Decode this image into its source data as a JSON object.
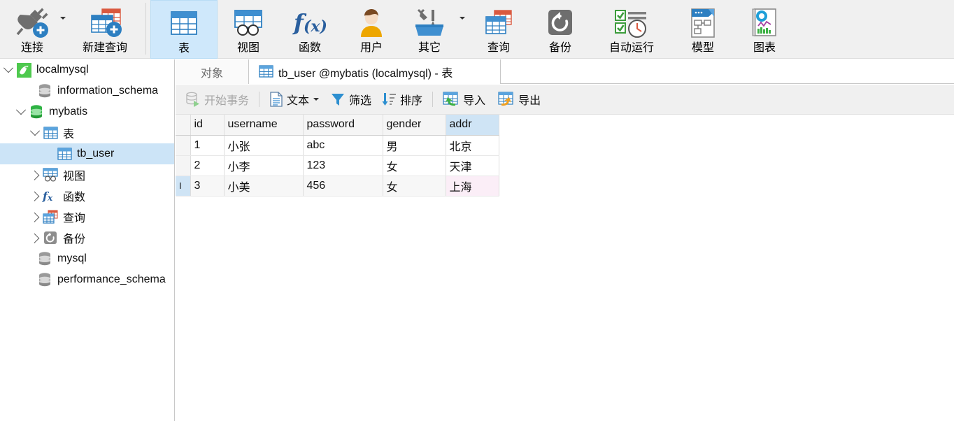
{
  "ribbon": {
    "items": [
      {
        "label": "连接",
        "icon": "plug-plus-icon",
        "has_caret": true,
        "selected": false
      },
      {
        "label": "新建查询",
        "icon": "new-query-icon",
        "has_caret": false,
        "selected": false
      },
      {
        "label": "表",
        "icon": "table-icon",
        "has_caret": false,
        "selected": true
      },
      {
        "label": "视图",
        "icon": "view-icon",
        "has_caret": false,
        "selected": false
      },
      {
        "label": "函数",
        "icon": "function-fx-icon",
        "has_caret": false,
        "selected": false
      },
      {
        "label": "用户",
        "icon": "user-icon",
        "has_caret": false,
        "selected": false
      },
      {
        "label": "其它",
        "icon": "other-tools-icon",
        "has_caret": true,
        "selected": false
      },
      {
        "label": "查询",
        "icon": "query-icon",
        "has_caret": false,
        "selected": false
      },
      {
        "label": "备份",
        "icon": "backup-icon",
        "has_caret": false,
        "selected": false
      },
      {
        "label": "自动运行",
        "icon": "automation-icon",
        "has_caret": false,
        "selected": false
      },
      {
        "label": "模型",
        "icon": "model-icon",
        "has_caret": false,
        "selected": false
      },
      {
        "label": "图表",
        "icon": "chart-icon",
        "has_caret": false,
        "selected": false
      }
    ]
  },
  "sidebar": {
    "items": [
      {
        "label": "localmysql",
        "icon": "connection-icon",
        "depth": 0,
        "expander": "down",
        "selected": false
      },
      {
        "label": "information_schema",
        "icon": "database-gray-icon",
        "depth": 1,
        "expander": "none",
        "selected": false
      },
      {
        "label": "mybatis",
        "icon": "database-green-icon",
        "depth": 1,
        "expander": "down",
        "selected": false
      },
      {
        "label": "表",
        "icon": "table-icon",
        "depth": 2,
        "expander": "down",
        "selected": false
      },
      {
        "label": "tb_user",
        "icon": "table-icon",
        "depth": 3,
        "expander": "none",
        "selected": true
      },
      {
        "label": "视图",
        "icon": "view-icon",
        "depth": 2,
        "expander": "right",
        "selected": false
      },
      {
        "label": "函数",
        "icon": "function-fx-icon",
        "depth": 2,
        "expander": "right",
        "selected": false
      },
      {
        "label": "查询",
        "icon": "query-icon",
        "depth": 2,
        "expander": "right",
        "selected": false
      },
      {
        "label": "备份",
        "icon": "backup-icon",
        "depth": 2,
        "expander": "right",
        "selected": false
      },
      {
        "label": "mysql",
        "icon": "database-gray-icon",
        "depth": 1,
        "expander": "none",
        "selected": false
      },
      {
        "label": "performance_schema",
        "icon": "database-gray-icon",
        "depth": 1,
        "expander": "none",
        "selected": false
      }
    ]
  },
  "tabs": {
    "object_tab": "对象",
    "active_tab": "tb_user @mybatis (localmysql) - 表"
  },
  "subtoolbar": {
    "begin_transaction": "开始事务",
    "text": "文本",
    "filter": "筛选",
    "sort": "排序",
    "import": "导入",
    "export": "导出"
  },
  "grid": {
    "columns": [
      "id",
      "username",
      "password",
      "gender",
      "addr"
    ],
    "selected_column": "addr",
    "rows": [
      {
        "id": "1",
        "username": "小张",
        "password": "abc",
        "gender": "男",
        "addr": "北京"
      },
      {
        "id": "2",
        "username": "小李",
        "password": "123",
        "gender": "女",
        "addr": "天津"
      },
      {
        "id": "3",
        "username": "小美",
        "password": "456",
        "gender": "女",
        "addr": "上海"
      }
    ],
    "current_row_index": 2,
    "current_cell_column": "addr",
    "cursor_glyph": "I"
  },
  "colors": {
    "ribbon_bg": "#f0f0f0",
    "selection_blue": "#cce4f7",
    "ribbon_selected": "#cfe8fb",
    "column_header_selected": "#cfe4f5",
    "current_cell_pink": "#fbeef7",
    "accent_blue": "#3f8fd0",
    "db_green": "#2fb344"
  }
}
